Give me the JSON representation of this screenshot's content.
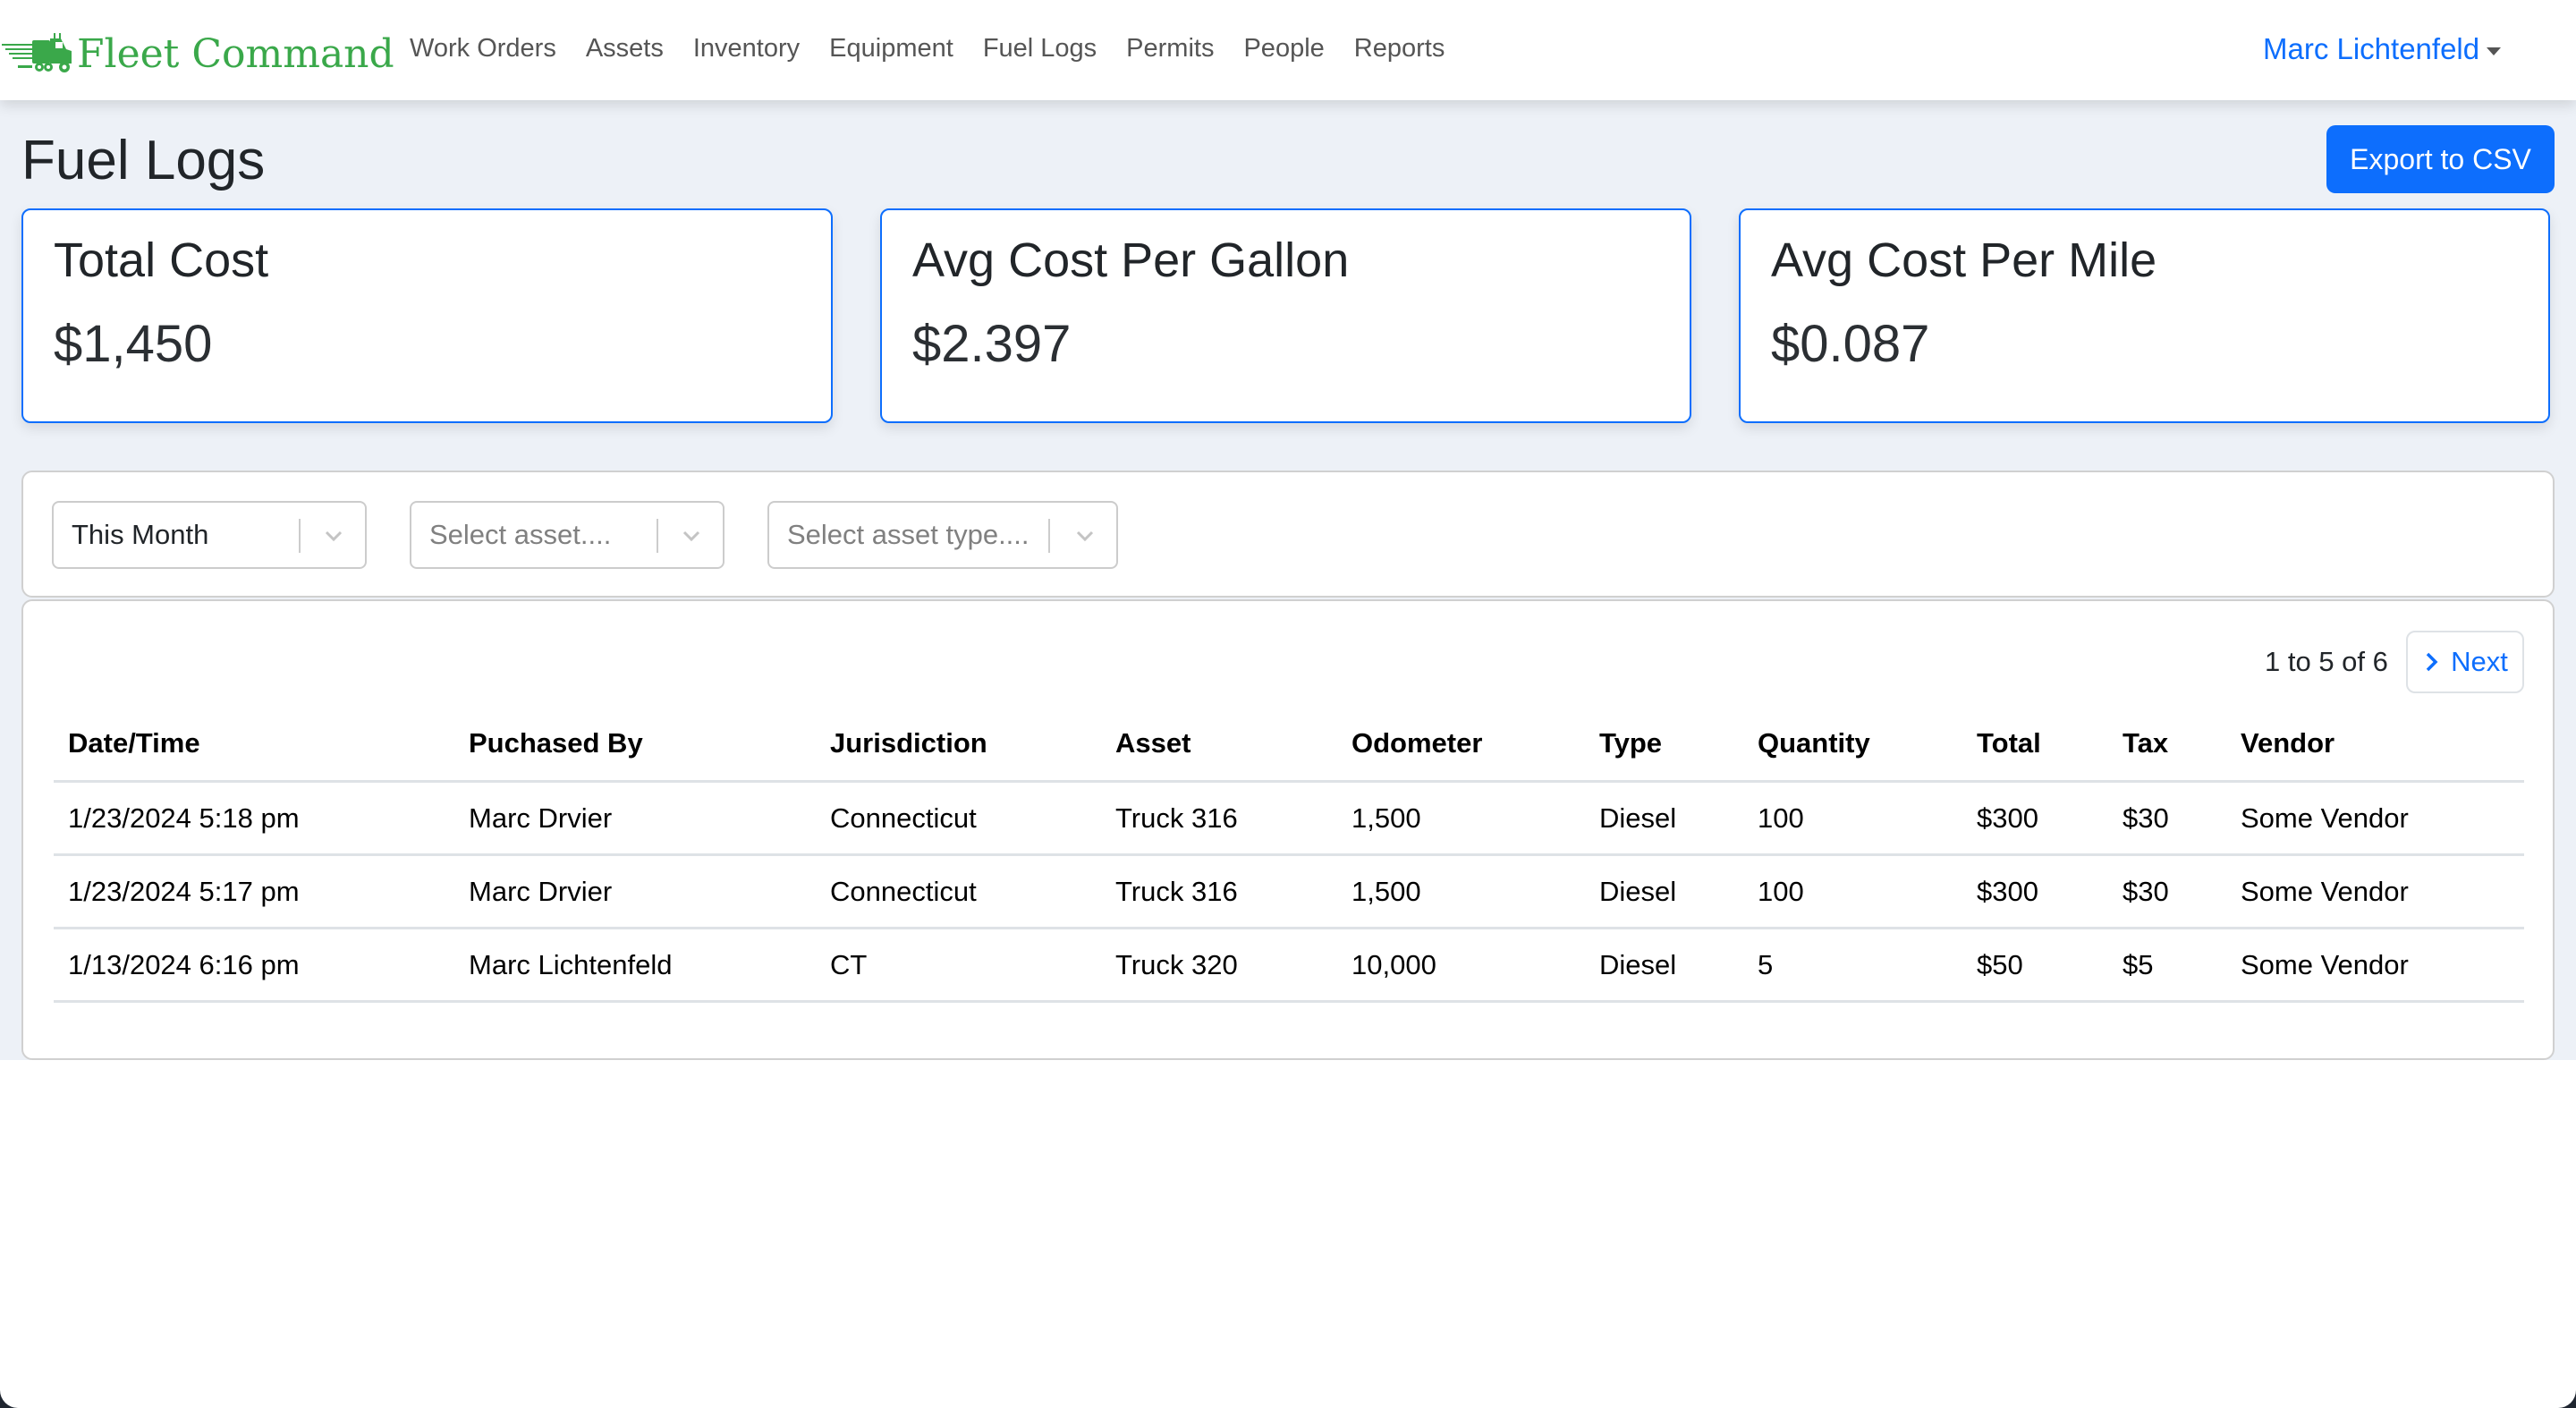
{
  "navbar": {
    "brand": "Fleet Command",
    "brand_color": "#3aa84a",
    "links": [
      {
        "label": "Work Orders"
      },
      {
        "label": "Assets"
      },
      {
        "label": "Inventory"
      },
      {
        "label": "Equipment"
      },
      {
        "label": "Fuel Logs"
      },
      {
        "label": "Permits"
      },
      {
        "label": "People"
      },
      {
        "label": "Reports"
      }
    ],
    "user_name": "Marc Lichtenfeld"
  },
  "page": {
    "title": "Fuel Logs",
    "export_label": "Export to CSV"
  },
  "stats": [
    {
      "label": "Total Cost",
      "value": "$1,450"
    },
    {
      "label": "Avg Cost Per Gallon",
      "value": "$2.397"
    },
    {
      "label": "Avg Cost Per Mile",
      "value": "$0.087"
    }
  ],
  "filters": {
    "period": {
      "value": "This Month"
    },
    "asset": {
      "placeholder": "Select asset...."
    },
    "asset_type": {
      "placeholder": "Select asset type...."
    }
  },
  "pagination": {
    "summary": "1 to 5 of 6",
    "next_label": "Next"
  },
  "table": {
    "columns": [
      "Date/Time",
      "Puchased By",
      "Jurisdiction",
      "Asset",
      "Odometer",
      "Type",
      "Quantity",
      "Total",
      "Tax",
      "Vendor"
    ],
    "rows": [
      [
        "1/23/2024 5:18 pm",
        "Marc Drvier",
        "Connecticut",
        "Truck 316",
        "1,500",
        "Diesel",
        "100",
        "$300",
        "$30",
        "Some Vendor"
      ],
      [
        "1/23/2024 5:17 pm",
        "Marc Drvier",
        "Connecticut",
        "Truck 316",
        "1,500",
        "Diesel",
        "100",
        "$300",
        "$30",
        "Some Vendor"
      ],
      [
        "1/13/2024 6:16 pm",
        "Marc Lichtenfeld",
        "CT",
        "Truck 320",
        "10,000",
        "Diesel",
        "5",
        "$50",
        "$5",
        "Some Vendor"
      ]
    ]
  },
  "colors": {
    "accent": "#0d6efd",
    "page_bg": "#edf1f7"
  }
}
